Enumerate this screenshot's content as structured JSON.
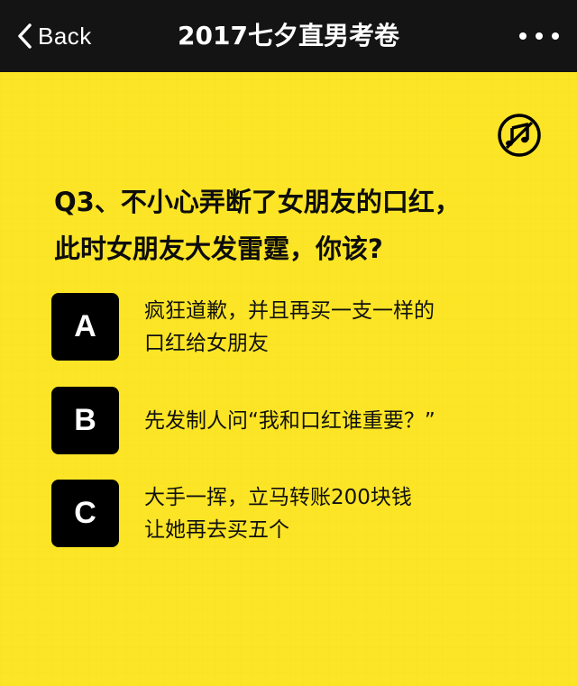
{
  "navbar": {
    "back_label": "Back",
    "title": "2017七夕直男考卷",
    "back_icon": "chevron-left-icon",
    "more_icon": "more-dots-icon"
  },
  "music": {
    "icon": "music-note-icon"
  },
  "question": {
    "line1": "Q3、不小心弄断了女朋友的口红，",
    "line2": "此时女朋友大发雷霆，你该?"
  },
  "options": [
    {
      "letter": "A",
      "line1": "疯狂道歉，并且再买一支一样的",
      "line2": "口红给女朋友"
    },
    {
      "letter": "B",
      "line1": "先发制人问“我和口红谁重要？”"
    },
    {
      "letter": "C",
      "line1": "大手一挥，立马转账200块钱",
      "line2": "让她再去买五个"
    }
  ],
  "colors": {
    "background": "#f8dc0a",
    "navbar": "#141414",
    "option_box": "#000000"
  }
}
